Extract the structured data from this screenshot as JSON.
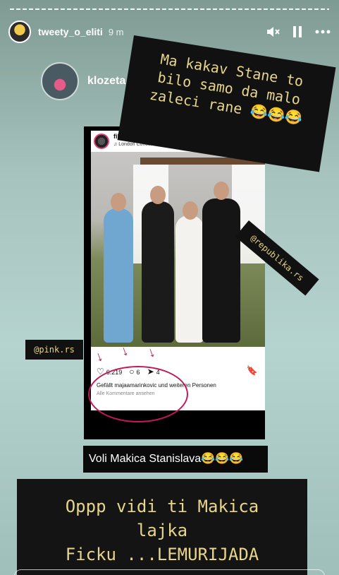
{
  "story": {
    "username": "tweety_o_eliti",
    "time": "9 m",
    "icons": [
      "mute-icon",
      "pause-icon",
      "more-icon"
    ]
  },
  "shared_story": {
    "username": "klozeta"
  },
  "captions": {
    "top": "Ma kakav Stane to\nbilo samo da malo\nzaleci rane 😂😂😂",
    "pink": "@pink.rs",
    "republika": "@republika.rs",
    "voli": "Voli Makica Stanislava😂😂😂",
    "bottom": "Oppp vidi ti Makica\nlajka\nFicku ...LEMURIJADA"
  },
  "post": {
    "username": "filip_car_capo_ck",
    "music": "London Concertante · The Godfather – Waltz",
    "likes_count": "6.219",
    "comments_count": "6",
    "shares_count": "4",
    "liked_by": "Gefällt majaamarinkovic und weiteren Personen",
    "comments_link": "Alle Kommentare ansehen"
  },
  "colors": {
    "caption_text": "#e7d58a",
    "highlight": "#c2185b"
  }
}
